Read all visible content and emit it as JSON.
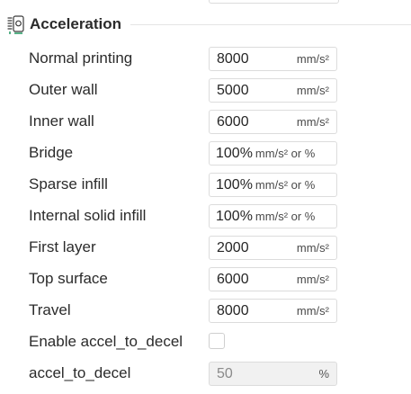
{
  "section": {
    "title": "Acceleration",
    "icon": "acceleration-settings-icon"
  },
  "rows": [
    {
      "label": "Normal printing",
      "value": "8000",
      "unit": "mm/s²"
    },
    {
      "label": "Outer wall",
      "value": "5000",
      "unit": "mm/s²"
    },
    {
      "label": "Inner wall",
      "value": "6000",
      "unit": "mm/s²"
    },
    {
      "label": "Bridge",
      "value": "100%",
      "unit": "mm/s² or %"
    },
    {
      "label": "Sparse infill",
      "value": "100%",
      "unit": "mm/s² or %"
    },
    {
      "label": "Internal solid infill",
      "value": "100%",
      "unit": "mm/s² or %"
    },
    {
      "label": "First layer",
      "value": "2000",
      "unit": "mm/s²"
    },
    {
      "label": "Top surface",
      "value": "6000",
      "unit": "mm/s²"
    },
    {
      "label": "Travel",
      "value": "8000",
      "unit": "mm/s²"
    }
  ],
  "accel_to_decel_toggle": {
    "label": "Enable accel_to_decel",
    "checked": false
  },
  "accel_to_decel": {
    "label": "accel_to_decel",
    "value": "50",
    "unit": "%",
    "disabled": true
  },
  "colors": {
    "field_border": "#dcdcdc",
    "disabled_bg": "#f1f1f1",
    "text": "#262626",
    "icon_green": "#2e9e6b"
  }
}
